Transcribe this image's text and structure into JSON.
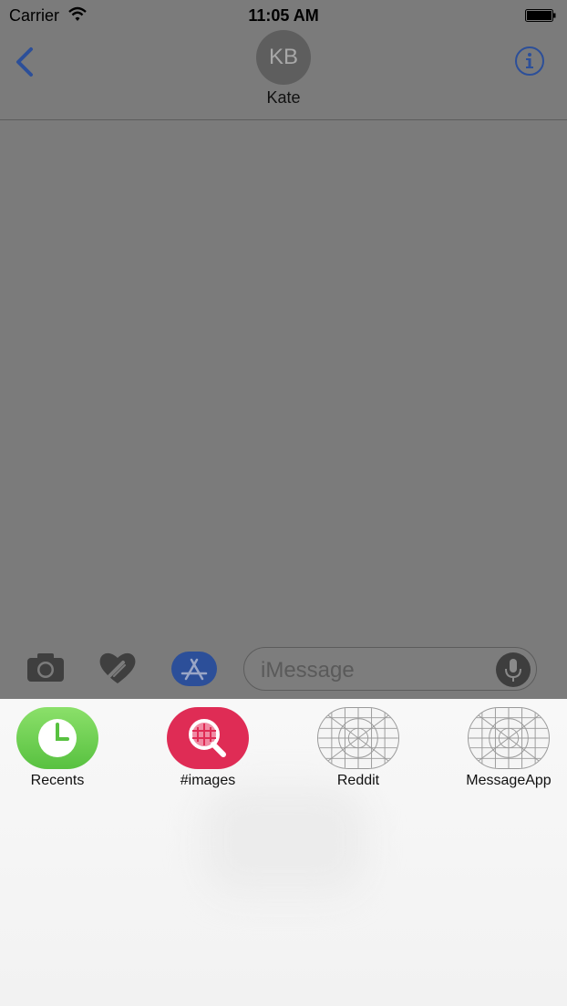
{
  "status_bar": {
    "carrier": "Carrier",
    "time": "11:05 AM"
  },
  "header": {
    "avatar_initials": "KB",
    "contact_name": "Kate"
  },
  "compose": {
    "placeholder": "iMessage"
  },
  "apps": [
    {
      "label": "Recents",
      "icon": "clock-icon"
    },
    {
      "label": "#images",
      "icon": "image-search-icon"
    },
    {
      "label": "Reddit",
      "icon": "placeholder-app-icon"
    },
    {
      "label": "MessageApp",
      "icon": "placeholder-app-icon"
    }
  ],
  "colors": {
    "accent": "#2c4f99",
    "overlay": "#7b7b7b",
    "recents_green": "#6acb4b",
    "images_red": "#df2c55"
  }
}
